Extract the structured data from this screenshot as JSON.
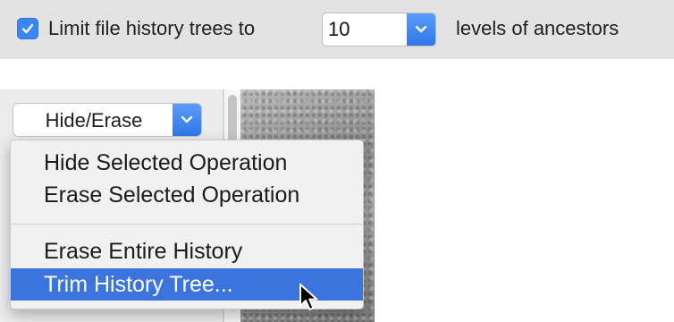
{
  "settings_bar": {
    "checkbox_checked": true,
    "label_prefix": "Limit file history trees to",
    "levels_value": "10",
    "label_suffix": "levels of ancestors"
  },
  "history_panel": {
    "popup_button_label": "Hide/Erase",
    "menu_items": [
      {
        "label": "Hide Selected Operation",
        "selected": false
      },
      {
        "label": "Erase Selected Operation",
        "selected": false
      },
      {
        "label": "Erase Entire History",
        "selected": false
      },
      {
        "label": "Trim History Tree...",
        "selected": true
      }
    ]
  },
  "colors": {
    "accent": "#3a74dc",
    "bar_background": "#e3e3e3",
    "menu_background": "#f1f1f1"
  },
  "icons": [
    "checkmark-icon",
    "chevron-down-icon",
    "mouse-pointer-icon"
  ]
}
